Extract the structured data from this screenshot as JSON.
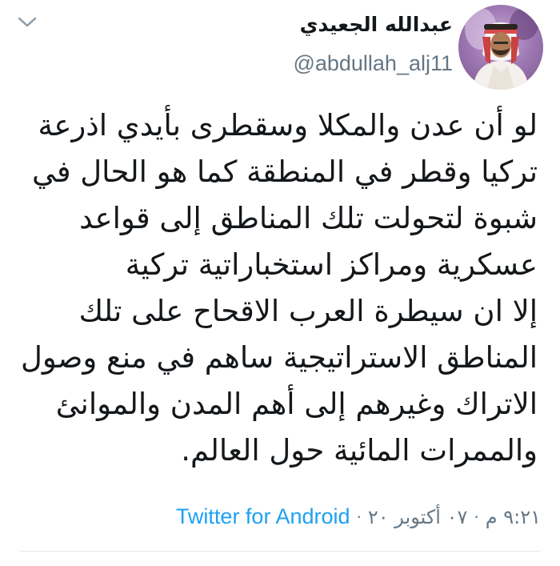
{
  "author": {
    "display_name": "عبدالله الجعيدي",
    "handle": "@abdullah_alj11",
    "avatar": "profile-photo"
  },
  "tweet": {
    "lines": [
      "لو أن عدن والمكلا وسقطرى بأيدي اذرعة",
      "تركيا وقطر في المنطقة كما هو الحال في",
      "شبوة لتحولت تلك المناطق إلى قواعد",
      "عسكرية ومراكز استخباراتية تركية",
      "إلا ان سيطرة العرب الاقحاح على تلك",
      "المناطق الاستراتيجية ساهم في منع وصول",
      "الاتراك وغيرهم إلى أهم المدن والموانئ",
      "والممرات المائية حول العالم."
    ]
  },
  "meta": {
    "time": "٩:٢١ م",
    "date": "٠٧ أكتوبر ٢٠",
    "separator": "·",
    "source": "Twitter for Android"
  },
  "icons": {
    "menu": "chevron-down-icon"
  },
  "colors": {
    "text": "#14171a",
    "secondary": "#657786",
    "link": "#1da1f2",
    "divider": "#e1e8ed"
  }
}
